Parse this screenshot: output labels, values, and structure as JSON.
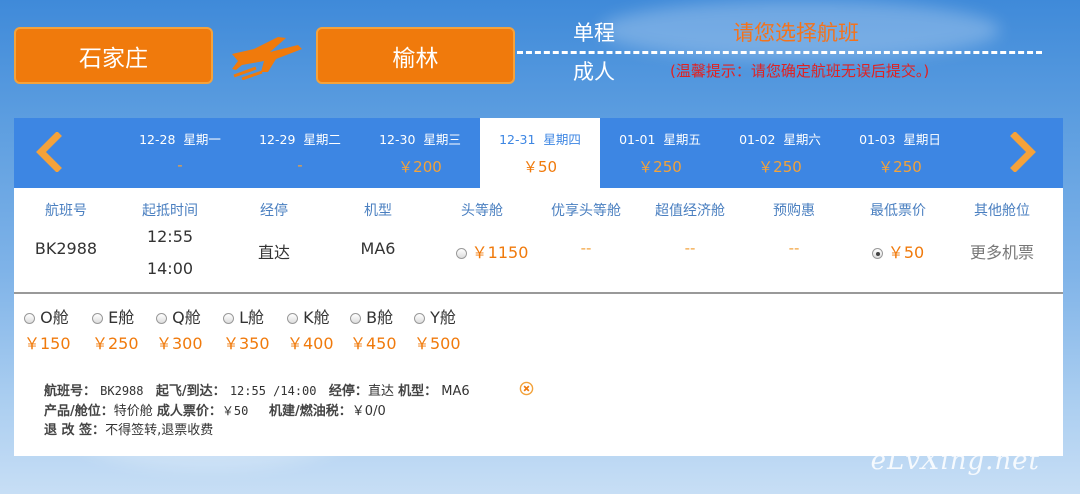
{
  "header": {
    "from_city": "石家庄",
    "to_city": "榆林",
    "trip_type": "单程",
    "passenger": "成人",
    "select_title": "请您选择航班",
    "notice": "(温馨提示：请您确定航班无误后提交。)"
  },
  "dates": [
    {
      "date": "12-28",
      "weekday": "星期一",
      "price": "-",
      "active": false
    },
    {
      "date": "12-29",
      "weekday": "星期二",
      "price": "-",
      "active": false
    },
    {
      "date": "12-30",
      "weekday": "星期三",
      "price": "￥200",
      "active": false
    },
    {
      "date": "12-31",
      "weekday": "星期四",
      "price": "￥50",
      "active": true
    },
    {
      "date": "01-01",
      "weekday": "星期五",
      "price": "￥250",
      "active": false
    },
    {
      "date": "01-02",
      "weekday": "星期六",
      "price": "￥250",
      "active": false
    },
    {
      "date": "01-03",
      "weekday": "星期日",
      "price": "￥250",
      "active": false
    }
  ],
  "table": {
    "headers": [
      "航班号",
      "起抵时间",
      "经停",
      "机型",
      "头等舱",
      "优享头等舱",
      "超值经济舱",
      "预购惠",
      "最低票价",
      "其他舱位"
    ],
    "row": {
      "flight_no": "BK2988",
      "depart": "12:55",
      "arrive": "14:00",
      "stops": "直达",
      "aircraft": "MA6",
      "first_class": "￥1150",
      "premium_first": "--",
      "value_economy": "--",
      "advance": "--",
      "lowest": "￥50",
      "other": "更多机票"
    }
  },
  "cabins": [
    {
      "name": "O舱",
      "price": "￥150"
    },
    {
      "name": "E舱",
      "price": "￥250"
    },
    {
      "name": "Q舱",
      "price": "￥300"
    },
    {
      "name": "L舱",
      "price": "￥350"
    },
    {
      "name": "K舱",
      "price": "￥400"
    },
    {
      "name": "B舱",
      "price": "￥450"
    },
    {
      "name": "Y舱",
      "price": "￥500"
    }
  ],
  "details": {
    "flight_label": "航班号：",
    "flight_value": "BK2988",
    "time_label": "起飞/到达：",
    "time_value": "12:55 /14:00",
    "stop_label": "经停：",
    "stop_value": "直达",
    "aircraft_label": "机型：",
    "aircraft_value": "MA6",
    "product_label": "产品/舱位：",
    "product_value": "特价舱",
    "fare_label": "成人票价：",
    "fare_value": "￥50",
    "tax_label": "机建/燃油税：",
    "tax_value": "￥0/0",
    "refund_label": "退 改 签：",
    "refund_value": "不得签转,退票收费"
  },
  "watermark": "eLvXing.net",
  "colors": {
    "accent": "#f07a0c",
    "bar": "#3d86e3",
    "notice": "#e02222"
  }
}
